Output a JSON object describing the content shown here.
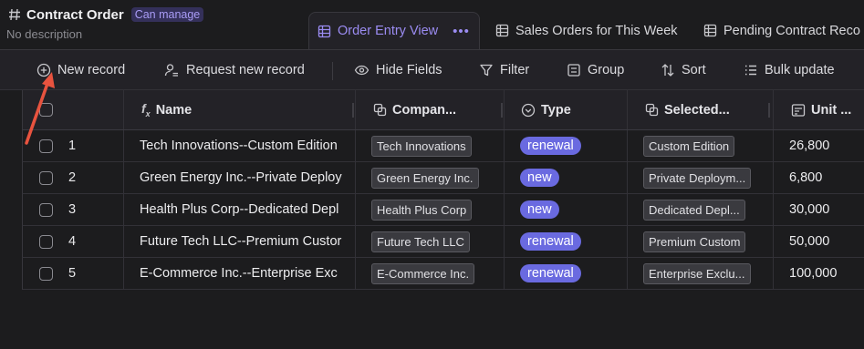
{
  "header": {
    "title": "Contract Order",
    "permission_badge": "Can manage",
    "description": "No description",
    "views": [
      {
        "label": "Order Entry View",
        "active": true,
        "more": "•••"
      },
      {
        "label": "Sales Orders for This Week",
        "active": false
      },
      {
        "label": "Pending Contract Reco",
        "active": false
      }
    ]
  },
  "toolbar": {
    "new_record": "New record",
    "request_new_record": "Request new record",
    "hide_fields": "Hide Fields",
    "filter": "Filter",
    "group": "Group",
    "sort": "Sort",
    "bulk_update": "Bulk update"
  },
  "table": {
    "columns": [
      "Name",
      "Compan...",
      "Type",
      "Selected...",
      "Unit ..."
    ],
    "rows": [
      {
        "index": "1",
        "name": "Tech Innovations--Custom Edition",
        "company": "Tech Innovations",
        "type": "renewal",
        "selected": "Custom Edition",
        "unit_price": "26,800"
      },
      {
        "index": "2",
        "name": "Green Energy Inc.--Private Deploy",
        "company": "Green Energy Inc.",
        "type": "new",
        "selected": "Private Deploym...",
        "unit_price": "6,800"
      },
      {
        "index": "3",
        "name": "Health Plus Corp--Dedicated Depl",
        "company": "Health Plus Corp",
        "type": "new",
        "selected": "Dedicated Depl...",
        "unit_price": "30,000"
      },
      {
        "index": "4",
        "name": "Future Tech LLC--Premium Custor",
        "company": "Future Tech LLC",
        "type": "renewal",
        "selected": "Premium Custom",
        "unit_price": "50,000"
      },
      {
        "index": "5",
        "name": "E-Commerce Inc.--Enterprise Exc",
        "company": "E-Commerce Inc.",
        "type": "renewal",
        "selected": "Enterprise Exclu...",
        "unit_price": "100,000"
      }
    ]
  },
  "colors": {
    "accent": "#9b8cf2",
    "type_pill": "#6a6ae0",
    "annotation_arrow": "#e8533f"
  }
}
